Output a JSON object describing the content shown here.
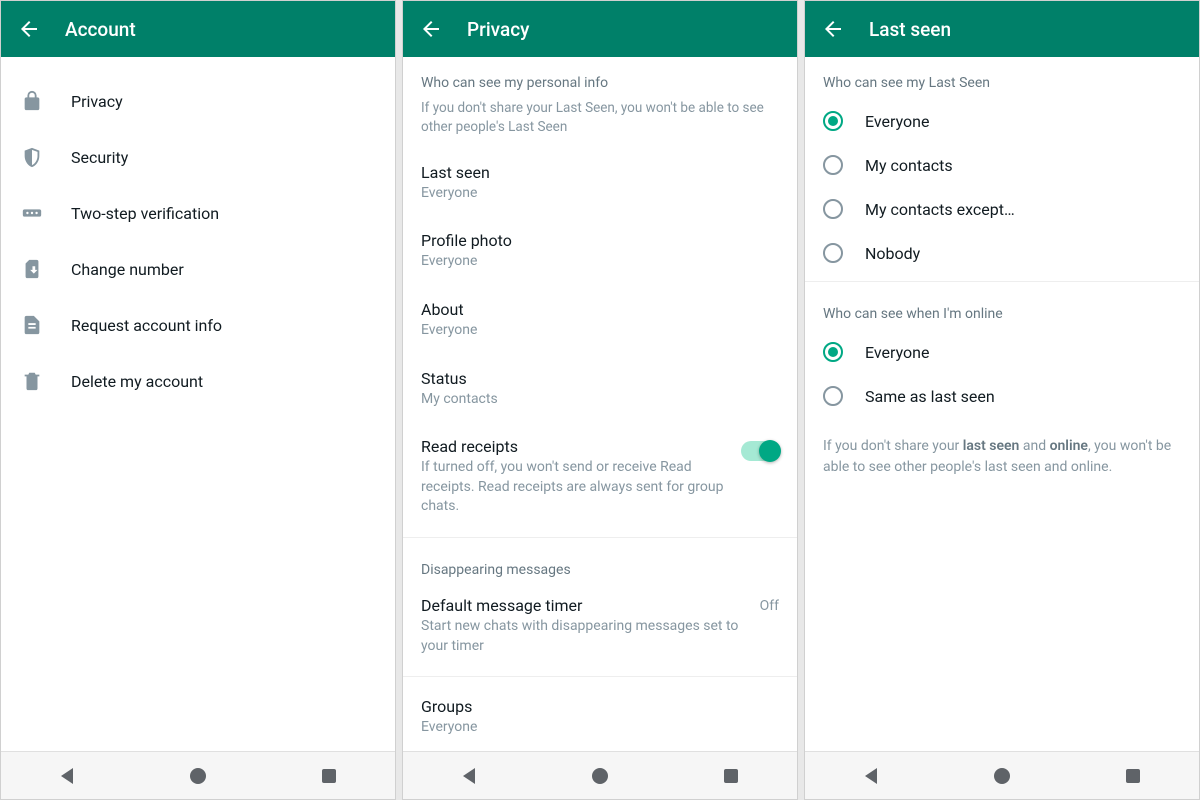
{
  "panel1": {
    "title": "Account",
    "items": [
      {
        "label": "Privacy"
      },
      {
        "label": "Security"
      },
      {
        "label": "Two-step verification"
      },
      {
        "label": "Change number"
      },
      {
        "label": "Request account info"
      },
      {
        "label": "Delete my account"
      }
    ]
  },
  "panel2": {
    "title": "Privacy",
    "section1_header": "Who can see my personal info",
    "section1_note": "If you don't share your Last Seen, you won't be able to see other people's Last Seen",
    "prefs": {
      "lastseen": {
        "title": "Last seen",
        "sub": "Everyone"
      },
      "photo": {
        "title": "Profile photo",
        "sub": "Everyone"
      },
      "about": {
        "title": "About",
        "sub": "Everyone"
      },
      "status": {
        "title": "Status",
        "sub": "My contacts"
      },
      "readreceipts": {
        "title": "Read receipts",
        "sub": "If turned off, you won't send or receive Read receipts. Read receipts are always sent for group chats."
      }
    },
    "section2_header": "Disappearing messages",
    "timer": {
      "title": "Default message timer",
      "sub": "Start new chats with disappearing messages set to your timer",
      "value": "Off"
    },
    "groups": {
      "title": "Groups",
      "sub": "Everyone"
    }
  },
  "panel3": {
    "title": "Last seen",
    "section1_header": "Who can see my Last Seen",
    "options1": [
      {
        "label": "Everyone",
        "selected": true
      },
      {
        "label": "My contacts",
        "selected": false
      },
      {
        "label": "My contacts except…",
        "selected": false
      },
      {
        "label": "Nobody",
        "selected": false
      }
    ],
    "section2_header": "Who can see when I'm online",
    "options2": [
      {
        "label": "Everyone",
        "selected": true
      },
      {
        "label": "Same as last seen",
        "selected": false
      }
    ],
    "footnote_pre": "If you don't share your ",
    "footnote_b1": "last seen",
    "footnote_mid": " and ",
    "footnote_b2": "online",
    "footnote_post": ", you won't be able to see other people's last seen and online."
  }
}
